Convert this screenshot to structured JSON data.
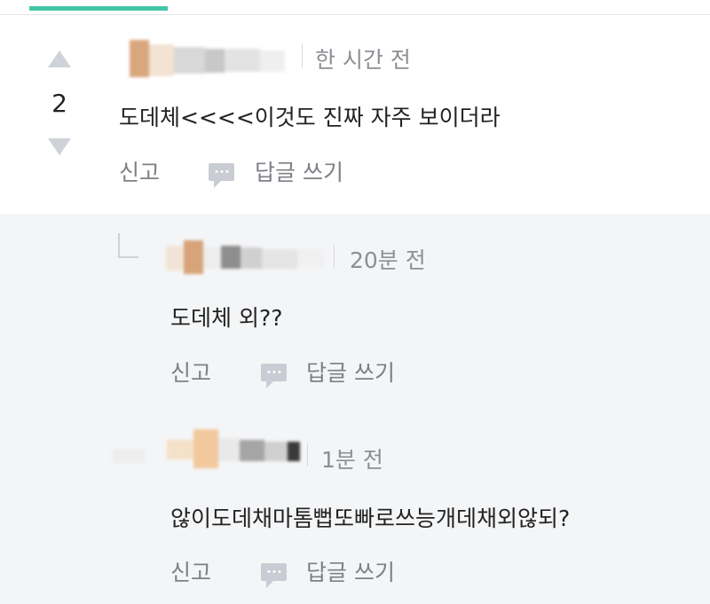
{
  "comments": [
    {
      "votes": "2",
      "time": "한 시간 전",
      "text": "도데체<<<<이것도 진짜 자주 보이더라",
      "report_label": "신고",
      "reply_label": "답글 쓰기"
    }
  ],
  "replies": [
    {
      "time": "20분 전",
      "text": "도데체 외??",
      "report_label": "신고",
      "reply_label": "답글 쓰기"
    },
    {
      "time": "1분 전",
      "text": "않이도데채마톰뻡또빠로쓰능개데채외않되?",
      "report_label": "신고",
      "reply_label": "답글 쓰기"
    }
  ],
  "icons": {
    "vote_up": "triangle-up-icon",
    "vote_down": "triangle-down-icon",
    "reply": "speech-bubble-icon",
    "reply_indent": "reply-arrow-icon"
  },
  "colors": {
    "accent": "#43c6a6",
    "reply_background": "#f4f5f7",
    "muted_text": "#8c8f94"
  }
}
